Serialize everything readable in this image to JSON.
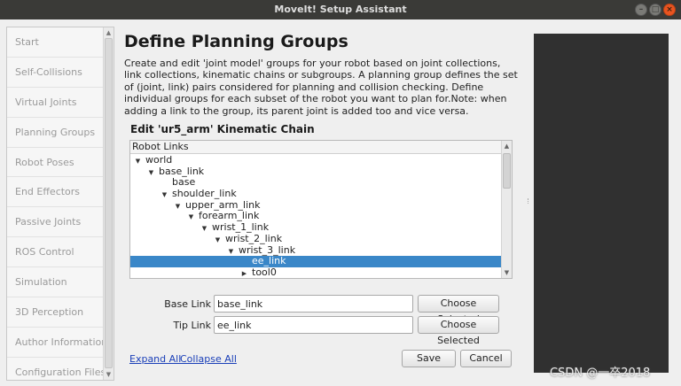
{
  "window": {
    "title": "MoveIt! Setup Assistant",
    "controls": [
      "minimize",
      "maximize",
      "close"
    ]
  },
  "sidebar": {
    "items": [
      {
        "label": "Start"
      },
      {
        "label": "Self-Collisions"
      },
      {
        "label": "Virtual Joints"
      },
      {
        "label": "Planning Groups"
      },
      {
        "label": "Robot Poses"
      },
      {
        "label": "End Effectors"
      },
      {
        "label": "Passive Joints"
      },
      {
        "label": "ROS Control"
      },
      {
        "label": "Simulation"
      },
      {
        "label": "3D Perception"
      },
      {
        "label": "Author Information"
      },
      {
        "label": "Configuration Files"
      }
    ]
  },
  "main": {
    "title": "Define Planning Groups",
    "description": "Create and edit 'joint model' groups for your robot based on joint collections, link collections, kinematic chains or subgroups. A planning group defines the set of (joint, link) pairs considered for planning and collision checking. Define individual groups for each subset of the robot you want to plan for.Note: when adding a link to the group, its parent joint is added too and vice versa.",
    "subtitle": "Edit 'ur5_arm' Kinematic Chain"
  },
  "tree": {
    "header": "Robot Links",
    "rows": [
      {
        "label": "world",
        "depth": 0,
        "expander": "expanded",
        "selected": false
      },
      {
        "label": "base_link",
        "depth": 1,
        "expander": "expanded",
        "selected": false
      },
      {
        "label": "base",
        "depth": 2,
        "expander": "none",
        "selected": false
      },
      {
        "label": "shoulder_link",
        "depth": 2,
        "expander": "expanded",
        "selected": false
      },
      {
        "label": "upper_arm_link",
        "depth": 3,
        "expander": "expanded",
        "selected": false
      },
      {
        "label": "forearm_link",
        "depth": 4,
        "expander": "expanded",
        "selected": false
      },
      {
        "label": "wrist_1_link",
        "depth": 5,
        "expander": "expanded",
        "selected": false
      },
      {
        "label": "wrist_2_link",
        "depth": 6,
        "expander": "expanded",
        "selected": false
      },
      {
        "label": "wrist_3_link",
        "depth": 7,
        "expander": "expanded",
        "selected": false
      },
      {
        "label": "ee_link",
        "depth": 8,
        "expander": "none",
        "selected": true
      },
      {
        "label": "tool0",
        "depth": 8,
        "expander": "collapsed",
        "selected": false
      }
    ]
  },
  "form": {
    "base_link_label": "Base Link",
    "base_link_value": "base_link",
    "tip_link_label": "Tip Link",
    "tip_link_value": "ee_link",
    "choose_selected_label": "Choose Selected"
  },
  "footer": {
    "expand_all": "Expand All",
    "collapse_all": "Collapse All",
    "save": "Save",
    "cancel": "Cancel"
  },
  "colors": {
    "selection": "#3a87c8",
    "titlebar": "#3a3a37",
    "viewer_background": "#303030",
    "close_button": "#e95420"
  },
  "watermark": "CSDN @一卒2018"
}
